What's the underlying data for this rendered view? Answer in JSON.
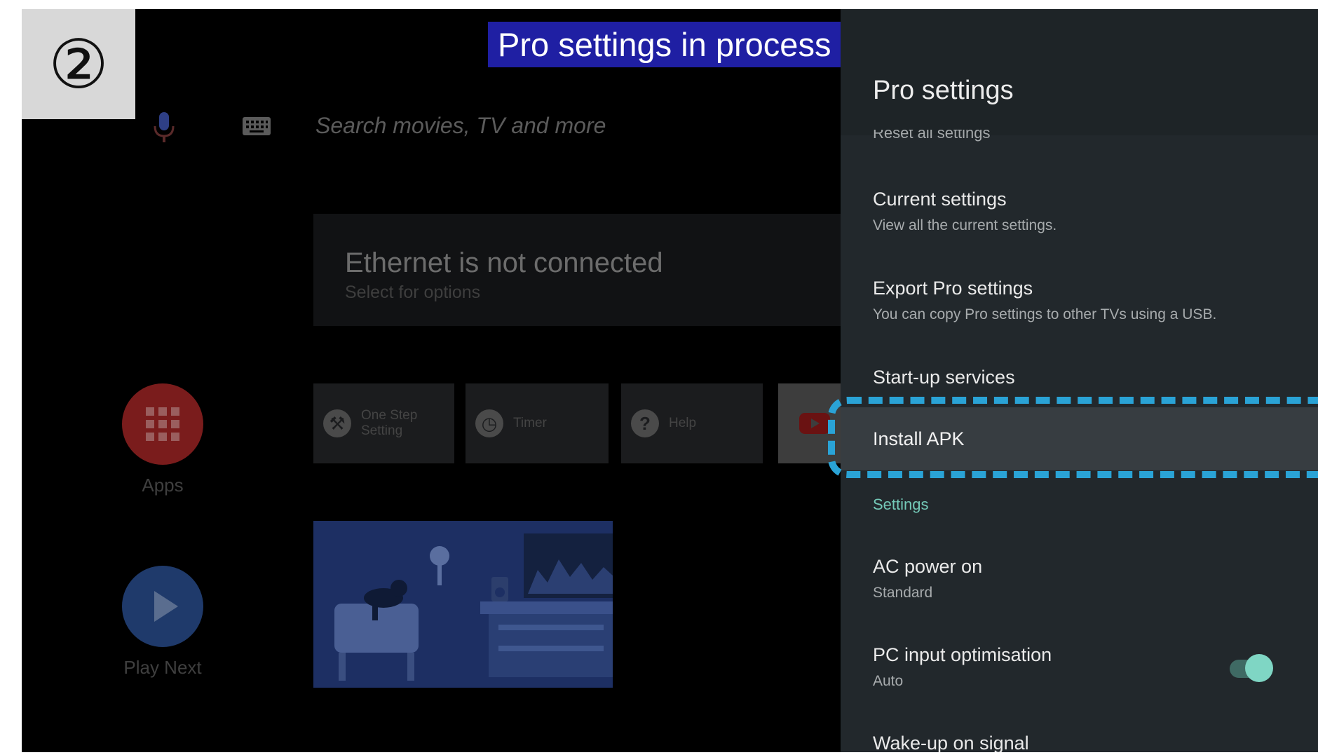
{
  "step_number": "②",
  "caption": "Pro settings in process",
  "home": {
    "search_placeholder": "Search movies, TV and more",
    "network_title": "Ethernet is not connected",
    "network_subtitle": "Select for options",
    "apps_label": "Apps",
    "play_next_label": "Play Next",
    "tiles": [
      {
        "label": "One Step Setting",
        "icon": "wrench-icon"
      },
      {
        "label": "Timer",
        "icon": "clock-icon"
      },
      {
        "label": "Help",
        "icon": "help-icon"
      }
    ]
  },
  "panel": {
    "title": "Pro settings",
    "partial_item": "Reset all settings",
    "items": [
      {
        "title": "Current settings",
        "subtitle": "View all the current settings."
      },
      {
        "title": "Export Pro settings",
        "subtitle": "You can copy Pro settings to other TVs using a USB."
      },
      {
        "title": "Start-up services",
        "subtitle": ""
      },
      {
        "title": "Install APK",
        "subtitle": ""
      },
      {
        "title": "",
        "subtitle": "Settings"
      },
      {
        "title": "AC power on",
        "subtitle": "Standard"
      },
      {
        "title": "PC input optimisation",
        "subtitle": "Auto"
      },
      {
        "title": "Wake-up on signal",
        "subtitle": ""
      }
    ],
    "pc_input_toggle_on": true
  },
  "colors": {
    "caption_bg": "#1f1fa3",
    "highlight": "#2aa3d6",
    "accent": "#74c9b8",
    "panel_bg": "#22282c"
  }
}
